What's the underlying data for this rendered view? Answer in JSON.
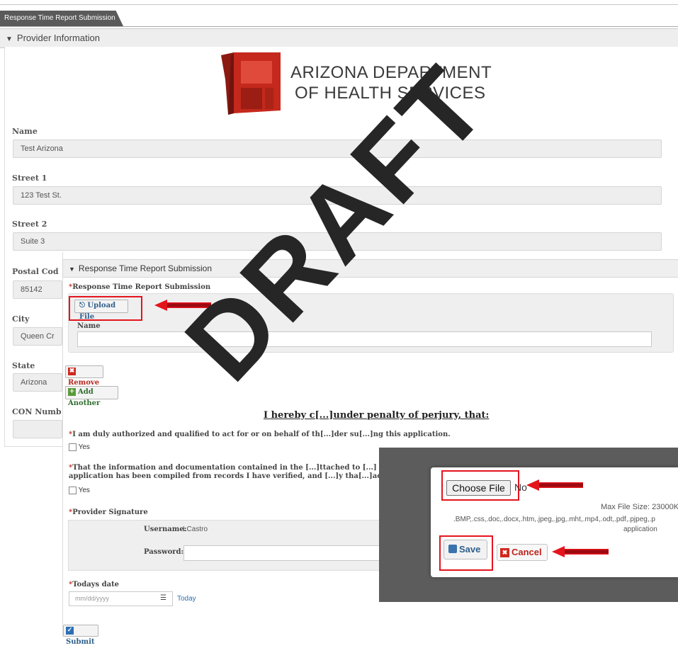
{
  "tab": {
    "label": "Response Time Report Submission"
  },
  "provider_section": {
    "title": "Provider Information"
  },
  "logo": {
    "line1": "ARIZONA DEPARTMENT",
    "line2": "OF HEALTH SERVICES"
  },
  "fields": {
    "name": {
      "label": "Name",
      "value": "Test Arizona"
    },
    "street1": {
      "label": "Street 1",
      "value": "123 Test St."
    },
    "street2": {
      "label": "Street 2",
      "value": "Suite 3"
    },
    "postal": {
      "label": "Postal Cod",
      "value": "85142"
    },
    "city": {
      "label": "City",
      "value": "Queen Cr"
    },
    "state": {
      "label": "State",
      "value": "Arizona"
    },
    "con": {
      "label": "CON Numb",
      "value": ""
    }
  },
  "rt_section": {
    "title": "Response Time Report Submission",
    "upload_label": "Response Time Report Submission",
    "upload_button": "Upload File",
    "name_label": "Name",
    "name_value": "",
    "remove_button": "Remove",
    "add_another_button": "Add Another",
    "certify_heading": "I hereby c[...]under penalty of perjury, that:",
    "stmt1": "I am duly authorized and qualified to act for or on behalf of th[...]der su[...]ng this application.",
    "stmt1_yes": "Yes",
    "stmt2_line1": "That the information and documentation contained in the [...]ttached to [...] form, submitted a",
    "stmt2_line2": "application has been compiled from records I have verified, and [...]y tha[...]acts recited herei",
    "stmt2_yes": "Yes",
    "signature_label": "Provider Signature",
    "username_label": "Username:",
    "username_value": "LCastro",
    "password_label": "Password:",
    "date_label": "Todays date",
    "date_placeholder": "mm/dd/yyyy",
    "today_link": "Today",
    "submit_button": "Submit"
  },
  "watermark": "DRAFT",
  "file_dialog": {
    "choose_button": "Choose File",
    "no_file_text": "No",
    "max_size": "Max File Size: 23000K",
    "types_line1": ".BMP,.css,.doc,.docx,.htm,.jpeg,.jpg,.mht,.mp4,.odt,.pdf,.pjpeg,.p",
    "types_line2": "application",
    "save_button": "Save",
    "cancel_button": "Cancel"
  },
  "colors": {
    "accent_red": "#e4141d",
    "logo_red": "#c5281c",
    "link_blue": "#2d5f8a"
  }
}
